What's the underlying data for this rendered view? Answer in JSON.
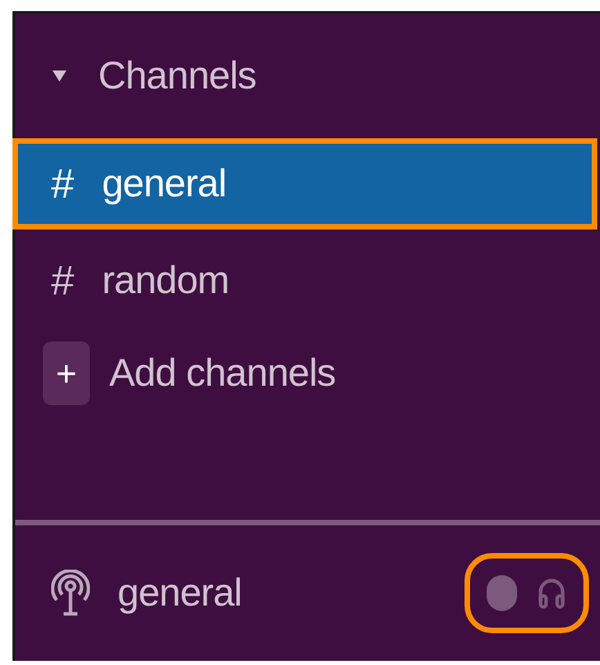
{
  "section": {
    "title": "Channels",
    "expanded": true
  },
  "channels": [
    {
      "symbol": "#",
      "name": "general",
      "selected": true,
      "highlighted": true
    },
    {
      "symbol": "#",
      "name": "random",
      "selected": false,
      "highlighted": false
    }
  ],
  "add_item": {
    "symbol": "+",
    "label": "Add channels"
  },
  "huddle": {
    "channel": "general",
    "toggle": {
      "on": false,
      "highlighted": true
    }
  }
}
